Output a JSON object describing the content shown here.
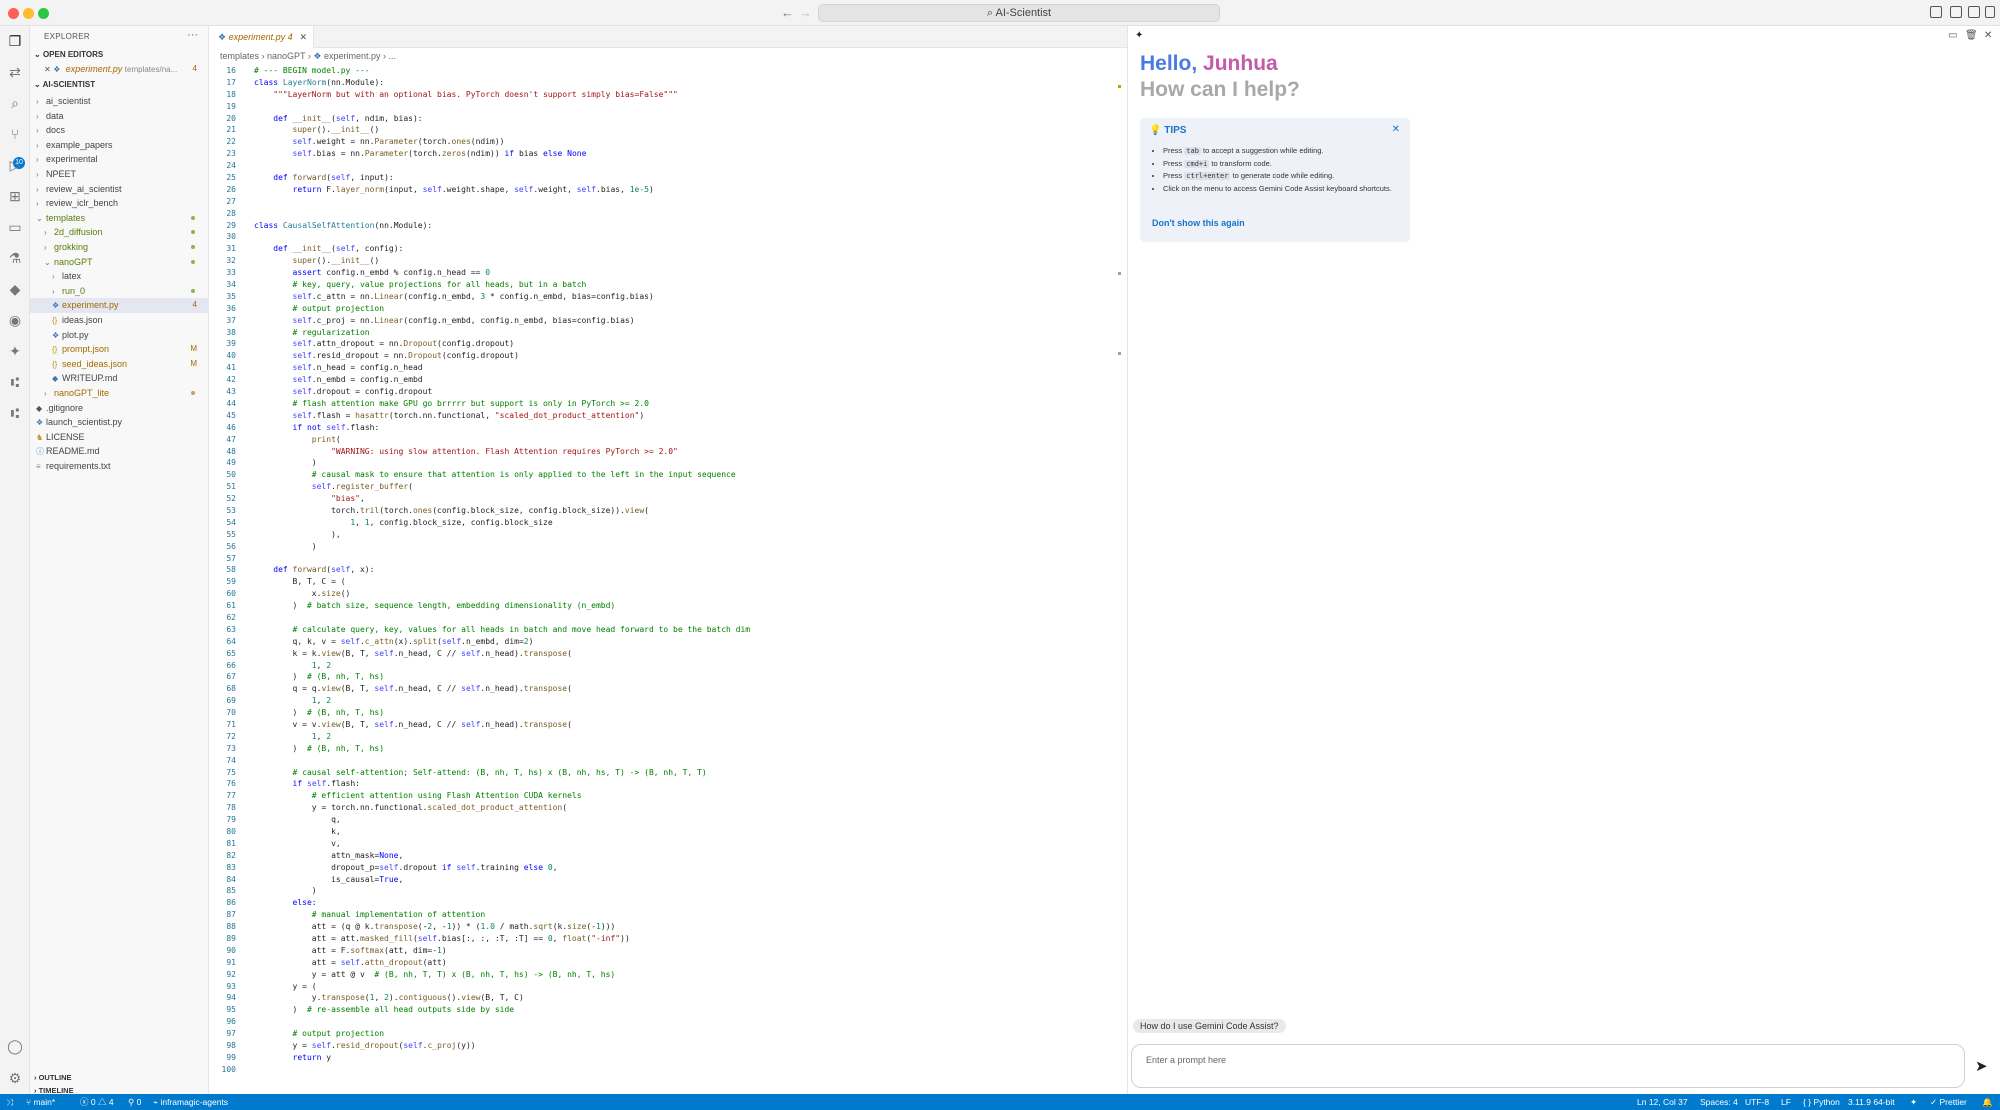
{
  "window": {
    "title": "AI-Scientist"
  },
  "explorer": {
    "title": "EXPLORER",
    "open_editors_label": "OPEN EDITORS",
    "open_editor_file": "experiment.py",
    "open_editor_path": "templates/na...",
    "open_editor_count": "4",
    "root_label": "AI-SCIENTIST",
    "items": [
      {
        "label": "ai_scientist",
        "type": "folder",
        "depth": 1
      },
      {
        "label": "data",
        "type": "folder",
        "depth": 1
      },
      {
        "label": "docs",
        "type": "folder",
        "depth": 1
      },
      {
        "label": "example_papers",
        "type": "folder",
        "depth": 1
      },
      {
        "label": "experimental",
        "type": "folder",
        "depth": 1
      },
      {
        "label": "NPEET",
        "type": "folder",
        "depth": 1
      },
      {
        "label": "review_ai_scientist",
        "type": "folder",
        "depth": 1
      },
      {
        "label": "review_iclr_bench",
        "type": "folder",
        "depth": 1
      },
      {
        "label": "templates",
        "type": "folder-open",
        "depth": 1,
        "status": "green"
      },
      {
        "label": "2d_diffusion",
        "type": "folder",
        "depth": 2,
        "status": "green"
      },
      {
        "label": "grokking",
        "type": "folder",
        "depth": 2,
        "status": "green"
      },
      {
        "label": "nanoGPT",
        "type": "folder-open",
        "depth": 2,
        "status": "green"
      },
      {
        "label": "latex",
        "type": "folder",
        "depth": 3
      },
      {
        "label": "run_0",
        "type": "folder",
        "depth": 3,
        "status": "green"
      },
      {
        "label": "experiment.py",
        "type": "py",
        "depth": 3,
        "mark": "4",
        "selected": true
      },
      {
        "label": "ideas.json",
        "type": "json",
        "depth": 3
      },
      {
        "label": "plot.py",
        "type": "py",
        "depth": 3
      },
      {
        "label": "prompt.json",
        "type": "json",
        "depth": 3,
        "mark": "M"
      },
      {
        "label": "seed_ideas.json",
        "type": "json",
        "depth": 3,
        "mark": "M"
      },
      {
        "label": "WRITEUP.md",
        "type": "md",
        "depth": 3
      },
      {
        "label": "nanoGPT_lite",
        "type": "folder",
        "depth": 2,
        "status": "orange"
      },
      {
        "label": ".gitignore",
        "type": "git",
        "depth": 1
      },
      {
        "label": "launch_scientist.py",
        "type": "py",
        "depth": 1
      },
      {
        "label": "LICENSE",
        "type": "lic",
        "depth": 1
      },
      {
        "label": "README.md",
        "type": "info",
        "depth": 1
      },
      {
        "label": "requirements.txt",
        "type": "txt",
        "depth": 1
      }
    ],
    "outline_label": "OUTLINE",
    "timeline_label": "TIMELINE"
  },
  "editor": {
    "tab_label": "experiment.py",
    "tab_count": "4",
    "breadcrumb": [
      "templates",
      "nanoGPT",
      "experiment.py",
      "..."
    ],
    "first_line": 16,
    "lines": [
      "# --- BEGIN model.py ---",
      "class LayerNorm(nn.Module):",
      "    \"\"\"LayerNorm but with an optional bias. PyTorch doesn't support simply bias=False\"\"\"",
      "",
      "    def __init__(self, ndim, bias):",
      "        super().__init__()",
      "        self.weight = nn.Parameter(torch.ones(ndim))",
      "        self.bias = nn.Parameter(torch.zeros(ndim)) if bias else None",
      "",
      "    def forward(self, input):",
      "        return F.layer_norm(input, self.weight.shape, self.weight, self.bias, 1e-5)",
      "",
      "",
      "class CausalSelfAttention(nn.Module):",
      "",
      "    def __init__(self, config):",
      "        super().__init__()",
      "        assert config.n_embd % config.n_head == 0",
      "        # key, query, value projections for all heads, but in a batch",
      "        self.c_attn = nn.Linear(config.n_embd, 3 * config.n_embd, bias=config.bias)",
      "        # output projection",
      "        self.c_proj = nn.Linear(config.n_embd, config.n_embd, bias=config.bias)",
      "        # regularization",
      "        self.attn_dropout = nn.Dropout(config.dropout)",
      "        self.resid_dropout = nn.Dropout(config.dropout)",
      "        self.n_head = config.n_head",
      "        self.n_embd = config.n_embd",
      "        self.dropout = config.dropout",
      "        # flash attention make GPU go brrrrr but support is only in PyTorch >= 2.0",
      "        self.flash = hasattr(torch.nn.functional, \"scaled_dot_product_attention\")",
      "        if not self.flash:",
      "            print(",
      "                \"WARNING: using slow attention. Flash Attention requires PyTorch >= 2.0\"",
      "            )",
      "            # causal mask to ensure that attention is only applied to the left in the input sequence",
      "            self.register_buffer(",
      "                \"bias\",",
      "                torch.tril(torch.ones(config.block_size, config.block_size)).view(",
      "                    1, 1, config.block_size, config.block_size",
      "                ),",
      "            )",
      "",
      "    def forward(self, x):",
      "        B, T, C = (",
      "            x.size()",
      "        )  # batch size, sequence length, embedding dimensionality (n_embd)",
      "",
      "        # calculate query, key, values for all heads in batch and move head forward to be the batch dim",
      "        q, k, v = self.c_attn(x).split(self.n_embd, dim=2)",
      "        k = k.view(B, T, self.n_head, C // self.n_head).transpose(",
      "            1, 2",
      "        )  # (B, nh, T, hs)",
      "        q = q.view(B, T, self.n_head, C // self.n_head).transpose(",
      "            1, 2",
      "        )  # (B, nh, T, hs)",
      "        v = v.view(B, T, self.n_head, C // self.n_head).transpose(",
      "            1, 2",
      "        )  # (B, nh, T, hs)",
      "",
      "        # causal self-attention; Self-attend: (B, nh, T, hs) x (B, nh, hs, T) -> (B, nh, T, T)",
      "        if self.flash:",
      "            # efficient attention using Flash Attention CUDA kernels",
      "            y = torch.nn.functional.scaled_dot_product_attention(",
      "                q,",
      "                k,",
      "                v,",
      "                attn_mask=None,",
      "                dropout_p=self.dropout if self.training else 0,",
      "                is_causal=True,",
      "            )",
      "        else:",
      "            # manual implementation of attention",
      "            att = (q @ k.transpose(-2, -1)) * (1.0 / math.sqrt(k.size(-1)))",
      "            att = att.masked_fill(self.bias[:, :, :T, :T] == 0, float(\"-inf\"))",
      "            att = F.softmax(att, dim=-1)",
      "            att = self.attn_dropout(att)",
      "            y = att @ v  # (B, nh, T, T) x (B, nh, T, hs) -> (B, nh, T, hs)",
      "        y = (",
      "            y.transpose(1, 2).contiguous().view(B, T, C)",
      "        )  # re-assemble all head outputs side by side",
      "",
      "        # output projection",
      "        y = self.resid_dropout(self.c_proj(y))",
      "        return y",
      ""
    ]
  },
  "chat": {
    "greeting_hello": "Hello,",
    "greeting_name": "Junhua",
    "subtitle": "How can I help?",
    "tips_title": "TIPS",
    "tips": [
      {
        "pre": "Press ",
        "key": "tab",
        "post": " to accept a suggestion while editing."
      },
      {
        "pre": "Press ",
        "key": "cmd+i",
        "post": " to transform code."
      },
      {
        "pre": "Press ",
        "key": "ctrl+enter",
        "post": " to generate code while editing."
      },
      {
        "pre": "Click on the menu to access Gemini Code Assist keyboard shortcuts.",
        "key": "",
        "post": ""
      }
    ],
    "tips_link": "Don't show this again",
    "suggestion": "How do I use Gemini Code Assist?",
    "prompt_placeholder": "Enter a prompt here"
  },
  "status": {
    "branch": "main*",
    "problems": "0",
    "warnings": "4",
    "ports": "0",
    "remote": "inframagic-agents",
    "cursor": "Ln 12, Col 37",
    "spaces": "Spaces: 4",
    "encoding": "UTF-8",
    "eol": "LF",
    "language": "Python",
    "interpreter": "3.11.9 64-bit",
    "formatter": "Prettier"
  },
  "colors": {
    "accent": "#007acc",
    "greeting_blue": "#4a7be0",
    "greeting_pink": "#c45aa8",
    "git_modified": "#a16a00",
    "git_added": "#587c0c"
  }
}
